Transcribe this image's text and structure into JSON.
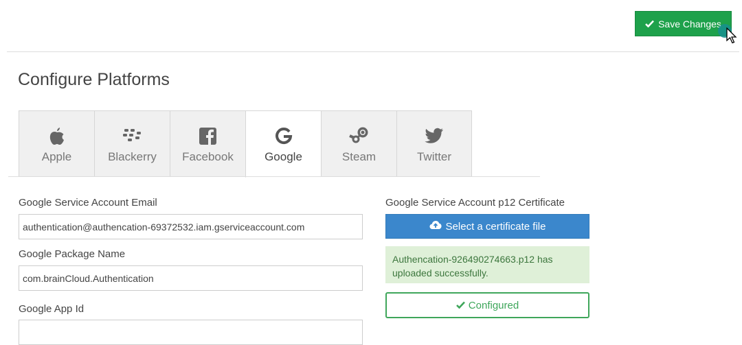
{
  "toolbar": {
    "save_label": "Save Changes"
  },
  "page": {
    "title": "Configure Platforms"
  },
  "tabs": [
    {
      "label": "Apple",
      "icon": "apple-icon"
    },
    {
      "label": "Blackerry",
      "icon": "blackberry-icon"
    },
    {
      "label": "Facebook",
      "icon": "facebook-icon"
    },
    {
      "label": "Google",
      "icon": "google-icon",
      "active": true
    },
    {
      "label": "Steam",
      "icon": "steam-icon"
    },
    {
      "label": "Twitter",
      "icon": "twitter-icon"
    }
  ],
  "form": {
    "email_label": "Google Service Account Email",
    "email_value": "authentication@authencation-69372532.iam.gserviceaccount.com",
    "package_label": "Google Package Name",
    "package_value": "com.brainCloud.Authentication",
    "appid_label": "Google App Id",
    "appid_value": "",
    "cert_label": "Google Service Account p12 Certificate",
    "cert_button": "Select a certificate file",
    "upload_message": "Authencation-926490274663.p12 has uploaded successfully.",
    "configured_label": "Configured"
  },
  "colors": {
    "save_green": "#1ea14b",
    "upload_blue": "#3b87cc",
    "success_bg": "#dff0d8",
    "configured_green": "#3ea65a"
  }
}
